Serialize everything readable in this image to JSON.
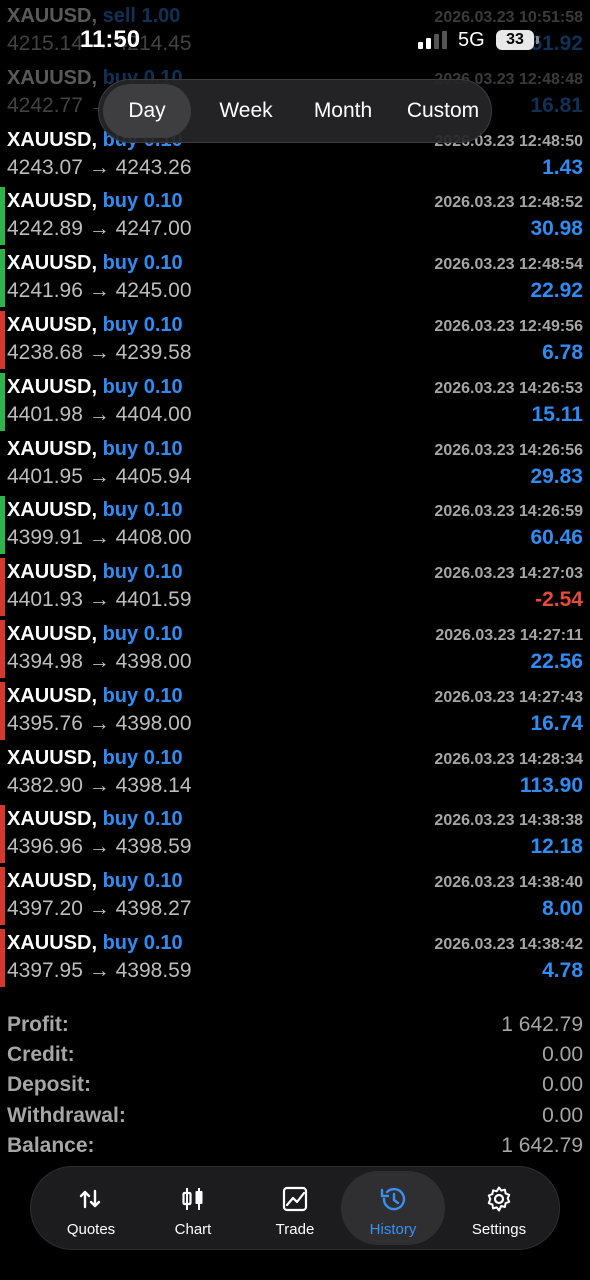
{
  "status": {
    "time": "11:50",
    "network": "5G",
    "battery": "33"
  },
  "periods": {
    "items": [
      "Day",
      "Week",
      "Month",
      "Custom"
    ],
    "active": "Day"
  },
  "deals": [
    {
      "symbol": "XAUUSD,",
      "side": "sell 1.00",
      "time": "2026.03.23 10:51:58",
      "open": "4215.14",
      "close": "4214.45",
      "profit": "51.92",
      "marker": "none",
      "faded": true
    },
    {
      "symbol": "XAUUSD,",
      "side": "buy 0.10",
      "time": "2026.03.23 12:48:48",
      "open": "4242.77",
      "close": "4242.9",
      "profit": "16.81",
      "marker": "none",
      "faded": true
    },
    {
      "symbol": "XAUUSD,",
      "side": "buy 0.10",
      "time": "2026.03.23 12:48:50",
      "open": "4243.07",
      "close": "4243.26",
      "profit": "1.43",
      "marker": "none"
    },
    {
      "symbol": "XAUUSD,",
      "side": "buy 0.10",
      "time": "2026.03.23 12:48:52",
      "open": "4242.89",
      "close": "4247.00",
      "profit": "30.98",
      "marker": "green"
    },
    {
      "symbol": "XAUUSD,",
      "side": "buy 0.10",
      "time": "2026.03.23 12:48:54",
      "open": "4241.96",
      "close": "4245.00",
      "profit": "22.92",
      "marker": "green"
    },
    {
      "symbol": "XAUUSD,",
      "side": "buy 0.10",
      "time": "2026.03.23 12:49:56",
      "open": "4238.68",
      "close": "4239.58",
      "profit": "6.78",
      "marker": "red"
    },
    {
      "symbol": "XAUUSD,",
      "side": "buy 0.10",
      "time": "2026.03.23 14:26:53",
      "open": "4401.98",
      "close": "4404.00",
      "profit": "15.11",
      "marker": "green"
    },
    {
      "symbol": "XAUUSD,",
      "side": "buy 0.10",
      "time": "2026.03.23 14:26:56",
      "open": "4401.95",
      "close": "4405.94",
      "profit": "29.83",
      "marker": "none"
    },
    {
      "symbol": "XAUUSD,",
      "side": "buy 0.10",
      "time": "2026.03.23 14:26:59",
      "open": "4399.91",
      "close": "4408.00",
      "profit": "60.46",
      "marker": "green"
    },
    {
      "symbol": "XAUUSD,",
      "side": "buy 0.10",
      "time": "2026.03.23 14:27:03",
      "open": "4401.93",
      "close": "4401.59",
      "profit": "-2.54",
      "marker": "red"
    },
    {
      "symbol": "XAUUSD,",
      "side": "buy 0.10",
      "time": "2026.03.23 14:27:11",
      "open": "4394.98",
      "close": "4398.00",
      "profit": "22.56",
      "marker": "red"
    },
    {
      "symbol": "XAUUSD,",
      "side": "buy 0.10",
      "time": "2026.03.23 14:27:43",
      "open": "4395.76",
      "close": "4398.00",
      "profit": "16.74",
      "marker": "red"
    },
    {
      "symbol": "XAUUSD,",
      "side": "buy 0.10",
      "time": "2026.03.23 14:28:34",
      "open": "4382.90",
      "close": "4398.14",
      "profit": "113.90",
      "marker": "none"
    },
    {
      "symbol": "XAUUSD,",
      "side": "buy 0.10",
      "time": "2026.03.23 14:38:38",
      "open": "4396.96",
      "close": "4398.59",
      "profit": "12.18",
      "marker": "red"
    },
    {
      "symbol": "XAUUSD,",
      "side": "buy 0.10",
      "time": "2026.03.23 14:38:40",
      "open": "4397.20",
      "close": "4398.27",
      "profit": "8.00",
      "marker": "red"
    },
    {
      "symbol": "XAUUSD,",
      "side": "buy 0.10",
      "time": "2026.03.23 14:38:42",
      "open": "4397.95",
      "close": "4398.59",
      "profit": "4.78",
      "marker": "red"
    }
  ],
  "arrow": "→",
  "summary": [
    {
      "label": "Profit:",
      "value": "1 642.79"
    },
    {
      "label": "Credit:",
      "value": "0.00"
    },
    {
      "label": "Deposit:",
      "value": "0.00"
    },
    {
      "label": "Withdrawal:",
      "value": "0.00"
    },
    {
      "label": "Balance:",
      "value": "1 642.79"
    }
  ],
  "tabs": [
    {
      "label": "Quotes",
      "icon": "quotes-icon"
    },
    {
      "label": "Chart",
      "icon": "candlestick-chart-icon"
    },
    {
      "label": "Trade",
      "icon": "trade-chart-icon"
    },
    {
      "label": "History",
      "icon": "history-clock-icon"
    },
    {
      "label": "Settings",
      "icon": "gear-icon"
    }
  ],
  "active_tab": "History",
  "colors": {
    "accent": "#2f8cf2",
    "negative": "#e9493b",
    "marker_green": "#2fb44a",
    "marker_red": "#d8382c",
    "muted": "#a6a6a6"
  }
}
